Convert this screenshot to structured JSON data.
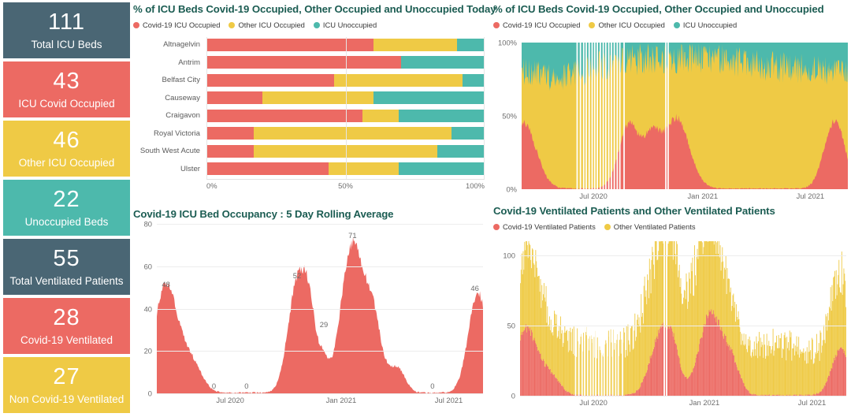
{
  "kpis": [
    {
      "value": "111",
      "label": "Total ICU Beds",
      "color": "#4a6674",
      "text": "#ffffff"
    },
    {
      "value": "43",
      "label": "ICU Covid Occupied",
      "color": "#ec6a63",
      "text": "#ffffff"
    },
    {
      "value": "46",
      "label": "Other ICU Occupied",
      "color": "#efca45",
      "text": "#ffffff"
    },
    {
      "value": "22",
      "label": "Unoccupied Beds",
      "color": "#4db9ac",
      "text": "#ffffff"
    },
    {
      "value": "55",
      "label": "Total Ventilated Patients",
      "color": "#4a6674",
      "text": "#ffffff"
    },
    {
      "value": "28",
      "label": "Covid-19 Ventilated",
      "color": "#ec6a63",
      "text": "#ffffff"
    },
    {
      "value": "27",
      "label": "Non Covid-19 Ventilated",
      "color": "#efca45",
      "text": "#ffffff"
    }
  ],
  "colors": {
    "covid": "#ec6a63",
    "other": "#efca45",
    "unoccupied": "#4db9ac",
    "dark": "#4a6674",
    "title": "#1b5c52"
  },
  "chart_data": [
    {
      "id": "hospital_stacked",
      "type": "bar",
      "orientation": "horizontal",
      "stacked": true,
      "title": "% of ICU Beds Covid-19 Occupied, Other Occupied and Unoccupied Today",
      "xlabel": "",
      "ylabel": "",
      "xlim": [
        0,
        100
      ],
      "xticks": [
        "0%",
        "50%",
        "100%"
      ],
      "xtick_values": [
        0,
        50,
        100
      ],
      "grid": true,
      "legend": [
        "Covid-19 ICU Occupied",
        "Other ICU Occupied",
        "ICU Unoccupied"
      ],
      "legend_position": "top-left",
      "categories": [
        "Altnagelvin",
        "Antrim",
        "Belfast City",
        "Causeway",
        "Craigavon",
        "Royal Victoria",
        "South West Acute",
        "Ulster"
      ],
      "series": [
        {
          "name": "Covid-19 ICU Occupied",
          "color": "#ec6a63",
          "values": [
            60,
            70,
            46,
            20,
            56,
            17,
            17,
            44
          ]
        },
        {
          "name": "Other ICU Occupied",
          "color": "#efca45",
          "values": [
            30,
            0,
            46,
            40,
            13,
            71,
            66,
            25
          ]
        },
        {
          "name": "ICU Unoccupied",
          "color": "#4db9ac",
          "values": [
            10,
            30,
            8,
            40,
            31,
            12,
            17,
            31
          ]
        }
      ]
    },
    {
      "id": "pct_icu_over_time",
      "type": "area",
      "stacked": true,
      "title": "% of ICU Beds Covid-19 Occupied, Other Occupied and Unoccupied",
      "xlabel": "",
      "ylabel": "",
      "ylim": [
        0,
        100
      ],
      "yticks": [
        "0%",
        "50%",
        "100%"
      ],
      "ytick_values": [
        0,
        50,
        100
      ],
      "xticks": [
        "Jul 2020",
        "Jan 2021",
        "Jul 2021"
      ],
      "xtick_fracs": [
        0.22,
        0.555,
        0.885
      ],
      "grid": false,
      "legend": [
        "Covid-19 ICU Occupied",
        "Other ICU Occupied",
        "ICU Unoccupied"
      ],
      "legend_position": "top-left",
      "series": [
        {
          "name": "Covid-19 ICU Occupied",
          "color": "#ec6a63"
        },
        {
          "name": "Other ICU Occupied",
          "color": "#efca45"
        },
        {
          "name": "ICU Unoccupied",
          "color": "#4db9ac"
        }
      ],
      "notes": "Daily stacked 100% area from ~Apr 2020 to ~Sep 2021. Covid share peaks ~45% around Nov 2020, ~48% around Jan 2021, near 0% Jul-Aug 2020 and May-Jun 2021, rising to ~46% at end."
    },
    {
      "id": "icu_occupancy_rolling",
      "type": "area",
      "title": "Covid-19 ICU Bed Occupancy : 5 Day Rolling Average",
      "xlabel": "",
      "ylabel": "",
      "ylim": [
        0,
        80
      ],
      "yticks": [
        "0",
        "20",
        "40",
        "60",
        "80"
      ],
      "ytick_values": [
        0,
        20,
        40,
        60,
        80
      ],
      "xticks": [
        "Jul 2020",
        "Jan 2021",
        "Jul 2021"
      ],
      "xtick_fracs": [
        0.225,
        0.565,
        0.895
      ],
      "grid": true,
      "color": "#ec6a63",
      "annotations": [
        {
          "label": "48",
          "x_frac": 0.028,
          "value": 48
        },
        {
          "label": "0",
          "x_frac": 0.175,
          "value": 0
        },
        {
          "label": "0",
          "x_frac": 0.275,
          "value": 0
        },
        {
          "label": "52",
          "x_frac": 0.43,
          "value": 52
        },
        {
          "label": "29",
          "x_frac": 0.512,
          "value": 29
        },
        {
          "label": "71",
          "x_frac": 0.6,
          "value": 71
        },
        {
          "label": "0",
          "x_frac": 0.845,
          "value": 0
        },
        {
          "label": "46",
          "x_frac": 0.975,
          "value": 46
        }
      ]
    },
    {
      "id": "ventilated_patients",
      "type": "bar",
      "stacked": true,
      "title": "Covid-19 Ventilated Patients and Other Ventilated Patients",
      "xlabel": "",
      "ylabel": "",
      "ylim": [
        0,
        110
      ],
      "yticks": [
        "0",
        "50",
        "100"
      ],
      "ytick_values": [
        0,
        50,
        100
      ],
      "xticks": [
        "Jul 2020",
        "Jan 2021",
        "Jul 2021"
      ],
      "xtick_fracs": [
        0.225,
        0.565,
        0.895
      ],
      "grid": true,
      "legend": [
        "Covid-19 Ventilated Patients",
        "Other Ventilated Patients"
      ],
      "legend_position": "top-left",
      "series": [
        {
          "name": "Covid-19 Ventilated Patients",
          "color": "#ec6a63"
        },
        {
          "name": "Other Ventilated Patients",
          "color": "#efca45"
        }
      ],
      "notes": "Daily stacked bars. Total peaks ~104 in Jan 2021; Covid component peaks ~60 in Jan 2021, ~47 in Apr 2020, ~43 in Nov 2020, ~33 in Sep 2021."
    }
  ]
}
